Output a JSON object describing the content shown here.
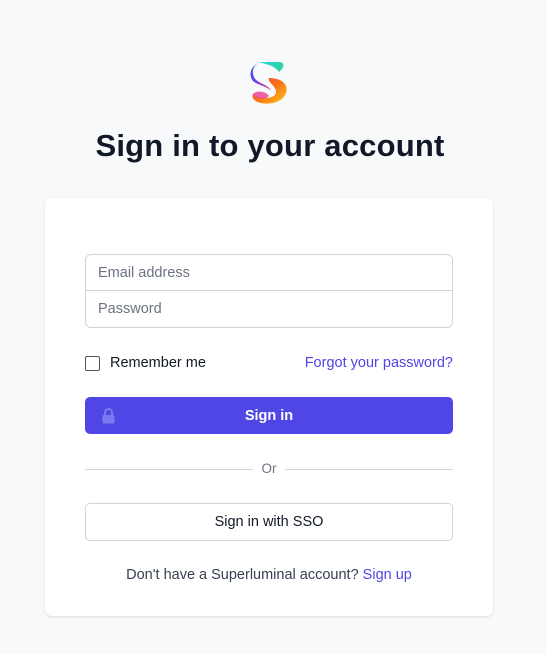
{
  "brand": {
    "logo_icon": "superluminal-s-logo-icon",
    "colors": {
      "accent": "#4f46e5",
      "text": "#111827",
      "muted": "#6b7280",
      "border": "#d1d5db",
      "background": "#f8f9fb"
    }
  },
  "header": {
    "title": "Sign in to your account"
  },
  "form": {
    "email_placeholder": "Email address",
    "password_placeholder": "Password",
    "remember_label": "Remember me",
    "remember_checked": false,
    "forgot_label": "Forgot your password?",
    "signin_label": "Sign in",
    "signin_icon": "lock-icon",
    "divider_label": "Or",
    "sso_label": "Sign in with SSO"
  },
  "footer": {
    "prompt": "Don't have a Superluminal account?",
    "signup_label": "Sign up"
  }
}
